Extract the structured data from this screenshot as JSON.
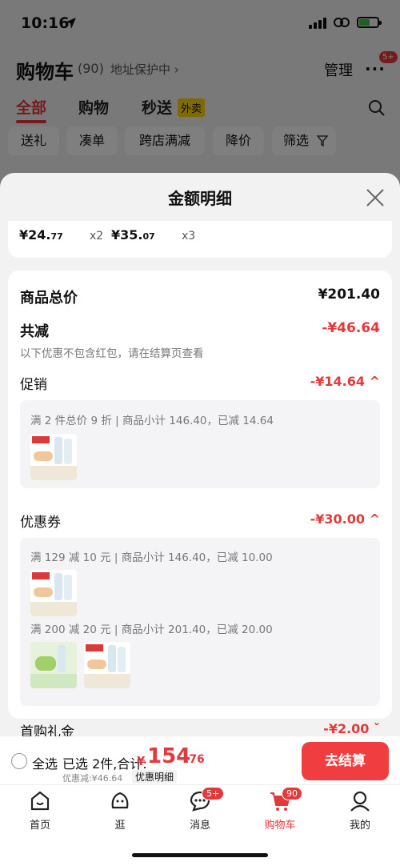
{
  "status": {
    "time": "10:16"
  },
  "header": {
    "title": "购物车",
    "count": "(90)",
    "address_protect": "地址保护中 ›",
    "manage": "管理",
    "more_badge": "5+"
  },
  "tabs": [
    {
      "label": "全部"
    },
    {
      "label": "购物"
    },
    {
      "label": "秒送"
    }
  ],
  "waimai_tag": "外卖",
  "filters": [
    "送礼",
    "凑单",
    "跨店满减",
    "降价",
    "筛选"
  ],
  "sheet": {
    "title": "金额明细",
    "items": [
      {
        "price_int": "¥24.",
        "price_frac": "77",
        "qty": "x2"
      },
      {
        "price_int": "¥35.",
        "price_frac": "07",
        "qty": "x3"
      }
    ],
    "total_label": "商品总价",
    "total_value": "¥201.40",
    "reduce_label": "共减",
    "reduce_value": "-¥46.64",
    "reduce_note": "以下优惠不包含红包，请在结算页查看",
    "promo_label": "促销",
    "promo_value": "-¥14.64 ^",
    "promo_line": "满 2 件总价 9 折 | 商品小计 146.40，已减 14.64",
    "coupon_label": "优惠券",
    "coupon_value": "-¥30.00 ^",
    "coupon_line_1": "满 129 减 10 元 | 商品小计 146.40，已减 10.00",
    "coupon_line_2": "满 200 减 20 元 | 商品小计 201.40，已减 20.00",
    "gift_label": "首购礼金",
    "gift_value": "-¥2.00 ˇ"
  },
  "checkout": {
    "select_all": "全选",
    "selected": "已选 2件,合计:",
    "yen": "¥",
    "total_int": "154",
    "total_frac": ".76",
    "discount": "优惠减:¥46.64",
    "detail": "优惠明细",
    "button": "去结算"
  },
  "tabbar": [
    {
      "label": "首页",
      "icon": "home-icon"
    },
    {
      "label": "逛",
      "icon": "browse-icon"
    },
    {
      "label": "消息",
      "icon": "message-icon",
      "badge": "5+"
    },
    {
      "label": "购物车",
      "icon": "cart-icon",
      "badge": "90"
    },
    {
      "label": "我的",
      "icon": "profile-icon"
    }
  ],
  "colors": {
    "accent": "#e4393c",
    "checkout_btn": "#ef3d40",
    "waimai": "#ffd400"
  }
}
